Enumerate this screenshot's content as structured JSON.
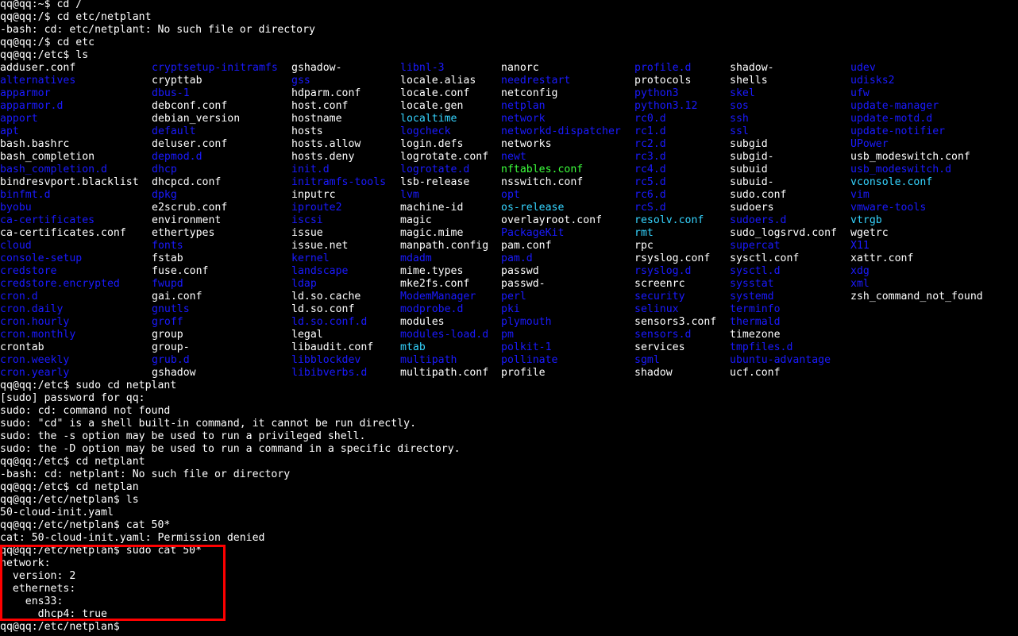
{
  "pre_lines": [
    "qq@qq:~$ cd /",
    "qq@qq:/$ cd etc/netplant",
    "-bash: cd: etc/netplant: No such file or directory",
    "qq@qq:/$ cd etc",
    "qq@qq:/etc$ ls"
  ],
  "ls_columns": [
    [
      {
        "name": "adduser.conf",
        "type": "file"
      },
      {
        "name": "alternatives",
        "type": "dir"
      },
      {
        "name": "apparmor",
        "type": "dir"
      },
      {
        "name": "apparmor.d",
        "type": "dir"
      },
      {
        "name": "apport",
        "type": "dir"
      },
      {
        "name": "apt",
        "type": "dir"
      },
      {
        "name": "bash.bashrc",
        "type": "file"
      },
      {
        "name": "bash_completion",
        "type": "file"
      },
      {
        "name": "bash_completion.d",
        "type": "dir"
      },
      {
        "name": "bindresvport.blacklist",
        "type": "file"
      },
      {
        "name": "binfmt.d",
        "type": "dir"
      },
      {
        "name": "byobu",
        "type": "dir"
      },
      {
        "name": "ca-certificates",
        "type": "dir"
      },
      {
        "name": "ca-certificates.conf",
        "type": "file"
      },
      {
        "name": "cloud",
        "type": "dir"
      },
      {
        "name": "console-setup",
        "type": "dir"
      },
      {
        "name": "credstore",
        "type": "dir"
      },
      {
        "name": "credstore.encrypted",
        "type": "dir"
      },
      {
        "name": "cron.d",
        "type": "dir"
      },
      {
        "name": "cron.daily",
        "type": "dir"
      },
      {
        "name": "cron.hourly",
        "type": "dir"
      },
      {
        "name": "cron.monthly",
        "type": "dir"
      },
      {
        "name": "crontab",
        "type": "file"
      },
      {
        "name": "cron.weekly",
        "type": "dir"
      },
      {
        "name": "cron.yearly",
        "type": "dir"
      }
    ],
    [
      {
        "name": "cryptsetup-initramfs",
        "type": "dir"
      },
      {
        "name": "crypttab",
        "type": "file"
      },
      {
        "name": "dbus-1",
        "type": "dir"
      },
      {
        "name": "debconf.conf",
        "type": "file"
      },
      {
        "name": "debian_version",
        "type": "file"
      },
      {
        "name": "default",
        "type": "dir"
      },
      {
        "name": "deluser.conf",
        "type": "file"
      },
      {
        "name": "depmod.d",
        "type": "dir"
      },
      {
        "name": "dhcp",
        "type": "dir"
      },
      {
        "name": "dhcpcd.conf",
        "type": "file"
      },
      {
        "name": "dpkg",
        "type": "dir"
      },
      {
        "name": "e2scrub.conf",
        "type": "file"
      },
      {
        "name": "environment",
        "type": "file"
      },
      {
        "name": "ethertypes",
        "type": "file"
      },
      {
        "name": "fonts",
        "type": "dir"
      },
      {
        "name": "fstab",
        "type": "file"
      },
      {
        "name": "fuse.conf",
        "type": "file"
      },
      {
        "name": "fwupd",
        "type": "dir"
      },
      {
        "name": "gai.conf",
        "type": "file"
      },
      {
        "name": "gnutls",
        "type": "dir"
      },
      {
        "name": "groff",
        "type": "dir"
      },
      {
        "name": "group",
        "type": "file"
      },
      {
        "name": "group-",
        "type": "file"
      },
      {
        "name": "grub.d",
        "type": "dir"
      },
      {
        "name": "gshadow",
        "type": "file"
      }
    ],
    [
      {
        "name": "gshadow-",
        "type": "file"
      },
      {
        "name": "gss",
        "type": "dir"
      },
      {
        "name": "hdparm.conf",
        "type": "file"
      },
      {
        "name": "host.conf",
        "type": "file"
      },
      {
        "name": "hostname",
        "type": "file"
      },
      {
        "name": "hosts",
        "type": "file"
      },
      {
        "name": "hosts.allow",
        "type": "file"
      },
      {
        "name": "hosts.deny",
        "type": "file"
      },
      {
        "name": "init.d",
        "type": "dir"
      },
      {
        "name": "initramfs-tools",
        "type": "dir"
      },
      {
        "name": "inputrc",
        "type": "file"
      },
      {
        "name": "iproute2",
        "type": "dir"
      },
      {
        "name": "iscsi",
        "type": "dir"
      },
      {
        "name": "issue",
        "type": "file"
      },
      {
        "name": "issue.net",
        "type": "file"
      },
      {
        "name": "kernel",
        "type": "dir"
      },
      {
        "name": "landscape",
        "type": "dir"
      },
      {
        "name": "ldap",
        "type": "dir"
      },
      {
        "name": "ld.so.cache",
        "type": "file"
      },
      {
        "name": "ld.so.conf",
        "type": "file"
      },
      {
        "name": "ld.so.conf.d",
        "type": "dir"
      },
      {
        "name": "legal",
        "type": "file"
      },
      {
        "name": "libaudit.conf",
        "type": "file"
      },
      {
        "name": "libblockdev",
        "type": "dir"
      },
      {
        "name": "libibverbs.d",
        "type": "dir"
      }
    ],
    [
      {
        "name": "libnl-3",
        "type": "dir"
      },
      {
        "name": "locale.alias",
        "type": "file"
      },
      {
        "name": "locale.conf",
        "type": "file"
      },
      {
        "name": "locale.gen",
        "type": "file"
      },
      {
        "name": "localtime",
        "type": "link"
      },
      {
        "name": "logcheck",
        "type": "dir"
      },
      {
        "name": "login.defs",
        "type": "file"
      },
      {
        "name": "logrotate.conf",
        "type": "file"
      },
      {
        "name": "logrotate.d",
        "type": "dir"
      },
      {
        "name": "lsb-release",
        "type": "file"
      },
      {
        "name": "lvm",
        "type": "dir"
      },
      {
        "name": "machine-id",
        "type": "file"
      },
      {
        "name": "magic",
        "type": "file"
      },
      {
        "name": "magic.mime",
        "type": "file"
      },
      {
        "name": "manpath.config",
        "type": "file"
      },
      {
        "name": "mdadm",
        "type": "dir"
      },
      {
        "name": "mime.types",
        "type": "file"
      },
      {
        "name": "mke2fs.conf",
        "type": "file"
      },
      {
        "name": "ModemManager",
        "type": "dir"
      },
      {
        "name": "modprobe.d",
        "type": "dir"
      },
      {
        "name": "modules",
        "type": "file"
      },
      {
        "name": "modules-load.d",
        "type": "dir"
      },
      {
        "name": "mtab",
        "type": "link"
      },
      {
        "name": "multipath",
        "type": "dir"
      },
      {
        "name": "multipath.conf",
        "type": "file"
      }
    ],
    [
      {
        "name": "nanorc",
        "type": "file"
      },
      {
        "name": "needrestart",
        "type": "dir"
      },
      {
        "name": "netconfig",
        "type": "file"
      },
      {
        "name": "netplan",
        "type": "dir"
      },
      {
        "name": "network",
        "type": "dir"
      },
      {
        "name": "networkd-dispatcher",
        "type": "dir"
      },
      {
        "name": "networks",
        "type": "file"
      },
      {
        "name": "newt",
        "type": "dir"
      },
      {
        "name": "nftables.conf",
        "type": "exec"
      },
      {
        "name": "nsswitch.conf",
        "type": "file"
      },
      {
        "name": "opt",
        "type": "dir"
      },
      {
        "name": "os-release",
        "type": "link"
      },
      {
        "name": "overlayroot.conf",
        "type": "file"
      },
      {
        "name": "PackageKit",
        "type": "dir"
      },
      {
        "name": "pam.conf",
        "type": "file"
      },
      {
        "name": "pam.d",
        "type": "dir"
      },
      {
        "name": "passwd",
        "type": "file"
      },
      {
        "name": "passwd-",
        "type": "file"
      },
      {
        "name": "perl",
        "type": "dir"
      },
      {
        "name": "pki",
        "type": "dir"
      },
      {
        "name": "plymouth",
        "type": "dir"
      },
      {
        "name": "pm",
        "type": "dir"
      },
      {
        "name": "polkit-1",
        "type": "dir"
      },
      {
        "name": "pollinate",
        "type": "dir"
      },
      {
        "name": "profile",
        "type": "file"
      }
    ],
    [
      {
        "name": "profile.d",
        "type": "dir"
      },
      {
        "name": "protocols",
        "type": "file"
      },
      {
        "name": "python3",
        "type": "dir"
      },
      {
        "name": "python3.12",
        "type": "dir"
      },
      {
        "name": "rc0.d",
        "type": "dir"
      },
      {
        "name": "rc1.d",
        "type": "dir"
      },
      {
        "name": "rc2.d",
        "type": "dir"
      },
      {
        "name": "rc3.d",
        "type": "dir"
      },
      {
        "name": "rc4.d",
        "type": "dir"
      },
      {
        "name": "rc5.d",
        "type": "dir"
      },
      {
        "name": "rc6.d",
        "type": "dir"
      },
      {
        "name": "rcS.d",
        "type": "dir"
      },
      {
        "name": "resolv.conf",
        "type": "link"
      },
      {
        "name": "rmt",
        "type": "link"
      },
      {
        "name": "rpc",
        "type": "file"
      },
      {
        "name": "rsyslog.conf",
        "type": "file"
      },
      {
        "name": "rsyslog.d",
        "type": "dir"
      },
      {
        "name": "screenrc",
        "type": "file"
      },
      {
        "name": "security",
        "type": "dir"
      },
      {
        "name": "selinux",
        "type": "dir"
      },
      {
        "name": "sensors3.conf",
        "type": "file"
      },
      {
        "name": "sensors.d",
        "type": "dir"
      },
      {
        "name": "services",
        "type": "file"
      },
      {
        "name": "sgml",
        "type": "dir"
      },
      {
        "name": "shadow",
        "type": "file"
      }
    ],
    [
      {
        "name": "shadow-",
        "type": "file"
      },
      {
        "name": "shells",
        "type": "file"
      },
      {
        "name": "skel",
        "type": "dir"
      },
      {
        "name": "sos",
        "type": "dir"
      },
      {
        "name": "ssh",
        "type": "dir"
      },
      {
        "name": "ssl",
        "type": "dir"
      },
      {
        "name": "subgid",
        "type": "file"
      },
      {
        "name": "subgid-",
        "type": "file"
      },
      {
        "name": "subuid",
        "type": "file"
      },
      {
        "name": "subuid-",
        "type": "file"
      },
      {
        "name": "sudo.conf",
        "type": "file"
      },
      {
        "name": "sudoers",
        "type": "file"
      },
      {
        "name": "sudoers.d",
        "type": "dir"
      },
      {
        "name": "sudo_logsrvd.conf",
        "type": "file"
      },
      {
        "name": "supercat",
        "type": "dir"
      },
      {
        "name": "sysctl.conf",
        "type": "file"
      },
      {
        "name": "sysctl.d",
        "type": "dir"
      },
      {
        "name": "sysstat",
        "type": "dir"
      },
      {
        "name": "systemd",
        "type": "dir"
      },
      {
        "name": "terminfo",
        "type": "dir"
      },
      {
        "name": "thermald",
        "type": "dir"
      },
      {
        "name": "timezone",
        "type": "file"
      },
      {
        "name": "tmpfiles.d",
        "type": "dir"
      },
      {
        "name": "ubuntu-advantage",
        "type": "dir"
      },
      {
        "name": "ucf.conf",
        "type": "file"
      }
    ],
    [
      {
        "name": "udev",
        "type": "dir"
      },
      {
        "name": "udisks2",
        "type": "dir"
      },
      {
        "name": "ufw",
        "type": "dir"
      },
      {
        "name": "update-manager",
        "type": "dir"
      },
      {
        "name": "update-motd.d",
        "type": "dir"
      },
      {
        "name": "update-notifier",
        "type": "dir"
      },
      {
        "name": "UPower",
        "type": "dir"
      },
      {
        "name": "usb_modeswitch.conf",
        "type": "file"
      },
      {
        "name": "usb_modeswitch.d",
        "type": "dir"
      },
      {
        "name": "vconsole.conf",
        "type": "link"
      },
      {
        "name": "vim",
        "type": "dir"
      },
      {
        "name": "vmware-tools",
        "type": "dir"
      },
      {
        "name": "vtrgb",
        "type": "link"
      },
      {
        "name": "wgetrc",
        "type": "file"
      },
      {
        "name": "X11",
        "type": "dir"
      },
      {
        "name": "xattr.conf",
        "type": "file"
      },
      {
        "name": "xdg",
        "type": "dir"
      },
      {
        "name": "xml",
        "type": "dir"
      },
      {
        "name": "zsh_command_not_found",
        "type": "file"
      }
    ]
  ],
  "post_lines": [
    "qq@qq:/etc$ sudo cd netplant",
    "[sudo] password for qq:",
    "sudo: cd: command not found",
    "sudo: \"cd\" is a shell built-in command, it cannot be run directly.",
    "sudo: the -s option may be used to run a privileged shell.",
    "sudo: the -D option may be used to run a command in a specific directory.",
    "qq@qq:/etc$ cd netplant",
    "-bash: cd: netplant: No such file or directory",
    "qq@qq:/etc$ cd netplan",
    "qq@qq:/etc/netplan$ ls",
    "50-cloud-init.yaml",
    "qq@qq:/etc/netplan$ cat 50*",
    "cat: 50-cloud-init.yaml: Permission denied",
    "qq@qq:/etc/netplan$ sudo cat 50*",
    "network:",
    "  version: 2",
    "  ethernets:",
    "    ens33:",
    "      dhcp4: true",
    "qq@qq:/etc/netplan$ "
  ],
  "colors": {
    "background": "#000000",
    "text": "#ffffff",
    "directory": "#1a1aff",
    "symlink": "#35d4ff",
    "executable": "#3cff3c",
    "highlight_box": "#ff0000"
  }
}
